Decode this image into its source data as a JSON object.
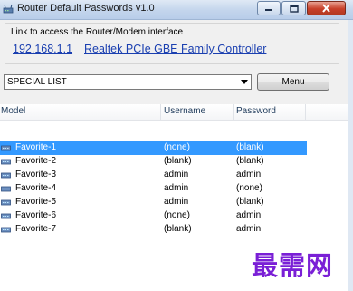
{
  "window": {
    "title": "Router Default Passwords v1.0"
  },
  "group": {
    "label": "Link to access the Router/Modem interface",
    "ip_link": "192.168.1.1",
    "adapter_link": "Realtek PCIe GBE Family Controller"
  },
  "controls": {
    "list_select_value": "SPECIAL LIST",
    "menu_label": "Menu"
  },
  "table": {
    "columns": [
      "Model",
      "Username",
      "Password"
    ],
    "rows": [
      {
        "model": "Favorite-1",
        "username": "(none)",
        "password": "(blank)",
        "selected": true
      },
      {
        "model": "Favorite-2",
        "username": "(blank)",
        "password": "(blank)",
        "selected": false
      },
      {
        "model": "Favorite-3",
        "username": "admin",
        "password": "admin",
        "selected": false
      },
      {
        "model": "Favorite-4",
        "username": "admin",
        "password": "(none)",
        "selected": false
      },
      {
        "model": "Favorite-5",
        "username": "admin",
        "password": "(blank)",
        "selected": false
      },
      {
        "model": "Favorite-6",
        "username": "(none)",
        "password": "admin",
        "selected": false
      },
      {
        "model": "Favorite-7",
        "username": "(blank)",
        "password": "admin",
        "selected": false
      }
    ]
  },
  "watermark": "最需网",
  "colors": {
    "selection": "#3399ff",
    "link": "#1a3fb0",
    "watermark": "#7a1fd6",
    "close_button": "#c8402a"
  },
  "icons": {
    "app": "router-icon",
    "row": "network-device-icon"
  }
}
